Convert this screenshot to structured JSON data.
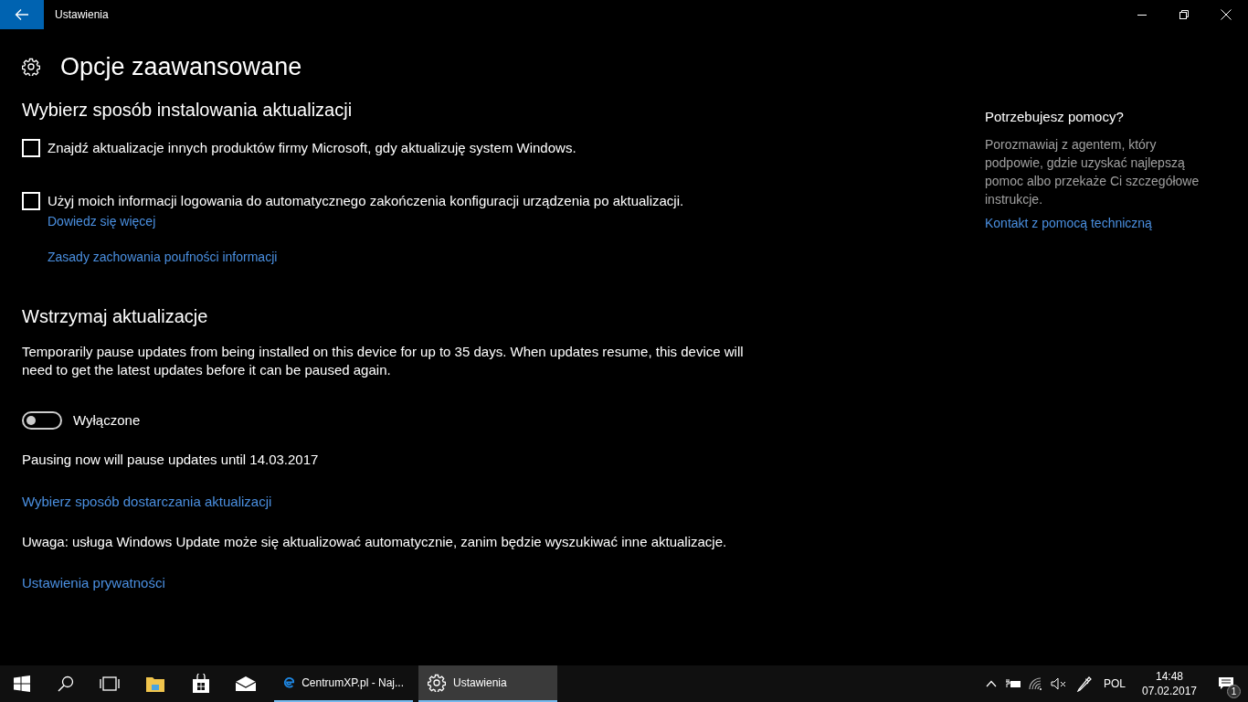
{
  "window": {
    "title": "Ustawienia"
  },
  "page_title": "Opcje zaawansowane",
  "install_section": {
    "heading": "Wybierz sposób instalowania aktualizacji",
    "checkboxes": [
      {
        "label": "Znajdź aktualizacje innych produktów firmy Microsoft, gdy aktualizuję system Windows.",
        "checked": false
      },
      {
        "label": "Użyj moich informacji logowania do automatycznego zakończenia konfiguracji urządzenia po aktualizacji.",
        "checked": false
      }
    ],
    "links": [
      "Dowiedz się więcej",
      "Zasady zachowania poufności informacji"
    ]
  },
  "pause_section": {
    "heading": "Wstrzymaj aktualizacje",
    "description": "Temporarily pause updates from being installed on this device for up to 35 days. When updates resume, this device will need to get the latest updates before it can be paused again.",
    "toggle": {
      "on": false,
      "label": "Wyłączone"
    },
    "pause_note": "Pausing now will pause updates until 14.03.2017"
  },
  "delivery_link": "Wybierz sposób dostarczania aktualizacji",
  "note": "Uwaga: usługa Windows Update może się aktualizować automatycznie, zanim będzie wyszukiwać inne aktualizacje.",
  "privacy_link": "Ustawienia prywatności",
  "help": {
    "heading": "Potrzebujesz pomocy?",
    "text": "Porozmawiaj z agentem, który podpowie, gdzie uzyskać najlepszą pomoc albo przekaże Ci szczegółowe instrukcje.",
    "link": "Kontakt z pomocą techniczną"
  },
  "taskbar": {
    "pinned": [
      {
        "kind": "start"
      },
      {
        "kind": "search"
      },
      {
        "kind": "taskview"
      },
      {
        "kind": "folder"
      },
      {
        "kind": "store"
      },
      {
        "kind": "mail"
      }
    ],
    "windows": [
      {
        "kind": "browser",
        "label": "CentrumXP.pl - Naj...",
        "selected": false
      },
      {
        "kind": "settings",
        "label": "Ustawienia",
        "selected": true
      }
    ],
    "language": "POL",
    "time": "14:48",
    "date": "07.02.2017",
    "notifications": "1"
  }
}
